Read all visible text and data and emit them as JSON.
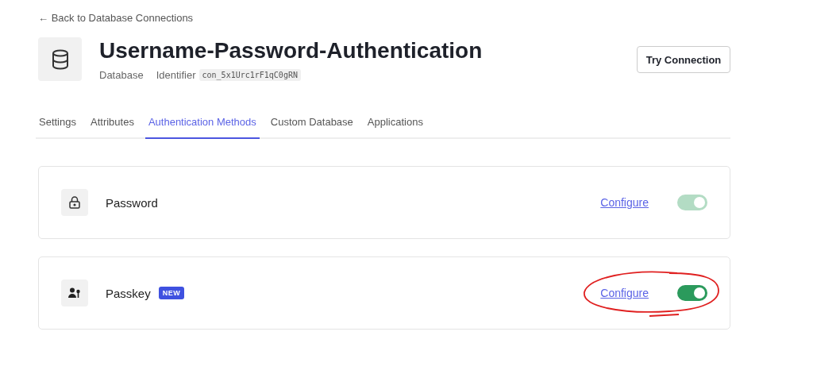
{
  "back_link": {
    "arrow": "←",
    "label": "Back to Database Connections"
  },
  "header": {
    "title": "Username-Password-Authentication",
    "type": "Database",
    "identifier_label": "Identifier",
    "identifier": "con_5x1Urc1rF1qC0gRN",
    "action": "Try Connection"
  },
  "tabs": [
    {
      "label": "Settings",
      "selected": false
    },
    {
      "label": "Attributes",
      "selected": false
    },
    {
      "label": "Authentication Methods",
      "selected": true
    },
    {
      "label": "Custom Database",
      "selected": false
    },
    {
      "label": "Applications",
      "selected": false
    }
  ],
  "methods": [
    {
      "kind": "lock",
      "name": "Password",
      "configure": "Configure",
      "on": true,
      "disabled": true,
      "annotated": false
    },
    {
      "kind": "person-key",
      "name": "Passkey",
      "badge": "NEW",
      "configure": "Configure",
      "on": true,
      "disabled": false,
      "annotated": true
    }
  ]
}
